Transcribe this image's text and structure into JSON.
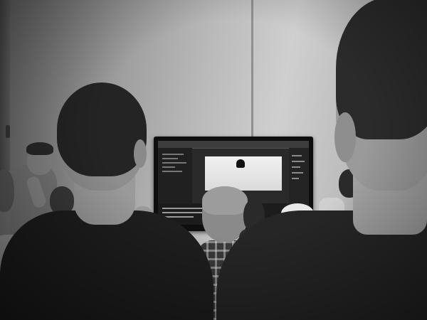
{
  "scene": {
    "description_tags": [
      "photo",
      "grayscale"
    ],
    "palette": {
      "wall_light": "#cfcfcf",
      "wall_dark": "#6b6b6b",
      "monitor": "#0e0e0e",
      "screen_bg": "#2a2a2a",
      "viewport": "#eeeeee",
      "skin": "#8a8a8a",
      "hair": "#1b1b1b",
      "shirt_dark": "#1e1e1e",
      "cap": "#e9e9e9"
    },
    "icons": [
      "monitor-icon"
    ]
  }
}
